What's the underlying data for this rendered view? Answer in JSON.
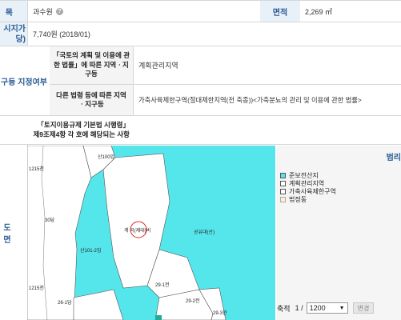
{
  "row1": {
    "label": "목",
    "value": "과수원",
    "help_icon": "?",
    "area_label": "면적",
    "area_value": "2,269 ㎡"
  },
  "row2": {
    "label_line1": "시지가",
    "label_line2": "당)",
    "value": "7,740원 (2018/01)"
  },
  "zone": {
    "label": "구등 지정여부",
    "national_header": "「국토의 계획 및 이용에 관한 법률」에 따른 지역ㆍ지구등",
    "national_value": "계획관리지역",
    "other_header": "다른 법령 등에 따른 지역ㆍ지구등",
    "other_value": "가축사육제한구역(절대제한지역(전 축종))<가축분뇨의 관리 및 이용에 관한 법률>"
  },
  "enforce": {
    "text_line1": "「토지이용규제 기본법 시행령」",
    "text_line2": "제9조제4항 각 호에 해당되는 사항"
  },
  "map": {
    "side_label": "도면",
    "parcels": [
      "산100임",
      "1215천",
      "30답",
      "산101-2임",
      "1215천",
      "26-1답",
      "29-1전",
      "29-2전",
      "29-3전"
    ],
    "main_parcel": "계 곡(제대)비",
    "east_label": "공유대(산)"
  },
  "legend": {
    "title": "범리",
    "items": [
      {
        "label": "준보전산지",
        "color": "#55e6ec"
      },
      {
        "label": "계획관리지역",
        "color": "#ffffff"
      },
      {
        "label": "가축사육제한구역",
        "color": "#ffffff"
      },
      {
        "label": "법정동",
        "color": "#f8f0e0"
      }
    ]
  },
  "scale": {
    "label": "축적",
    "prefix": "1 /",
    "value": "1200",
    "button": "변경"
  }
}
